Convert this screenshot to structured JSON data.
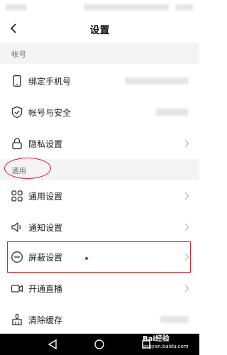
{
  "header": {
    "title": "设置"
  },
  "sections": {
    "account": {
      "label": "帐号"
    },
    "general": {
      "label": "通用"
    }
  },
  "rows": [
    {
      "id": "bind-phone",
      "label": "绑定手机号",
      "icon": "phone-icon"
    },
    {
      "id": "account-security",
      "label": "帐号与安全",
      "icon": "shield-check-icon"
    },
    {
      "id": "privacy",
      "label": "隐私设置",
      "icon": "lock-icon"
    },
    {
      "id": "general-settings",
      "label": "通用设置",
      "icon": "grid-icon"
    },
    {
      "id": "notification",
      "label": "通知设置",
      "icon": "speaker-icon"
    },
    {
      "id": "block-settings",
      "label": "屏蔽设置",
      "icon": "minus-circle-icon"
    },
    {
      "id": "live",
      "label": "开通直播",
      "icon": "video-camera-icon"
    },
    {
      "id": "clear-cache",
      "label": "清除缓存",
      "icon": "broom-icon"
    }
  ],
  "watermark": {
    "brand": "Bai经验",
    "url": "jingyan.baidu.com"
  },
  "colors": {
    "accent_red": "#d6262a",
    "section_bg": "#f4f4f4",
    "navbar": "#000000"
  }
}
